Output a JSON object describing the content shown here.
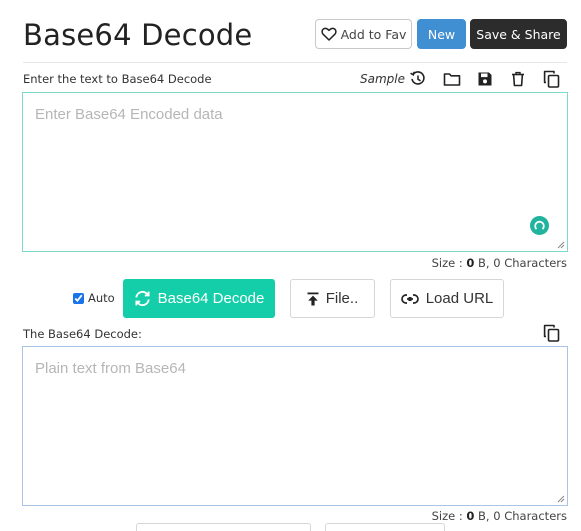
{
  "header": {
    "title": "Base64 Decode",
    "fav_label": "Add to Fav",
    "new_label": "New",
    "save_share_label": "Save & Share"
  },
  "input": {
    "label": "Enter the text to Base64 Decode",
    "sample_label": "Sample",
    "placeholder": "Enter Base64 Encoded data",
    "value": "",
    "size_prefix": "Size : ",
    "size_bytes": "0",
    "size_suffix": " B, 0 Characters",
    "toolbar_icons": [
      "history-icon",
      "folder-icon",
      "save-icon",
      "trash-icon",
      "copy-icon"
    ]
  },
  "actions": {
    "auto_label": "Auto",
    "auto_checked": true,
    "decode_label": "Base64 Decode",
    "file_label": "File..",
    "load_url_label": "Load URL"
  },
  "output": {
    "label": "The Base64 Decode:",
    "placeholder": "Plain text from Base64",
    "value": "",
    "size_prefix": "Size : ",
    "size_bytes": "0",
    "size_suffix": " B, 0 Characters"
  },
  "colors": {
    "decode_button": "#14cea9",
    "new_button": "#3f8fd2",
    "save_button": "#2c2c2c",
    "input_border": "#7fd9cb",
    "output_border": "#a9c4e6"
  }
}
